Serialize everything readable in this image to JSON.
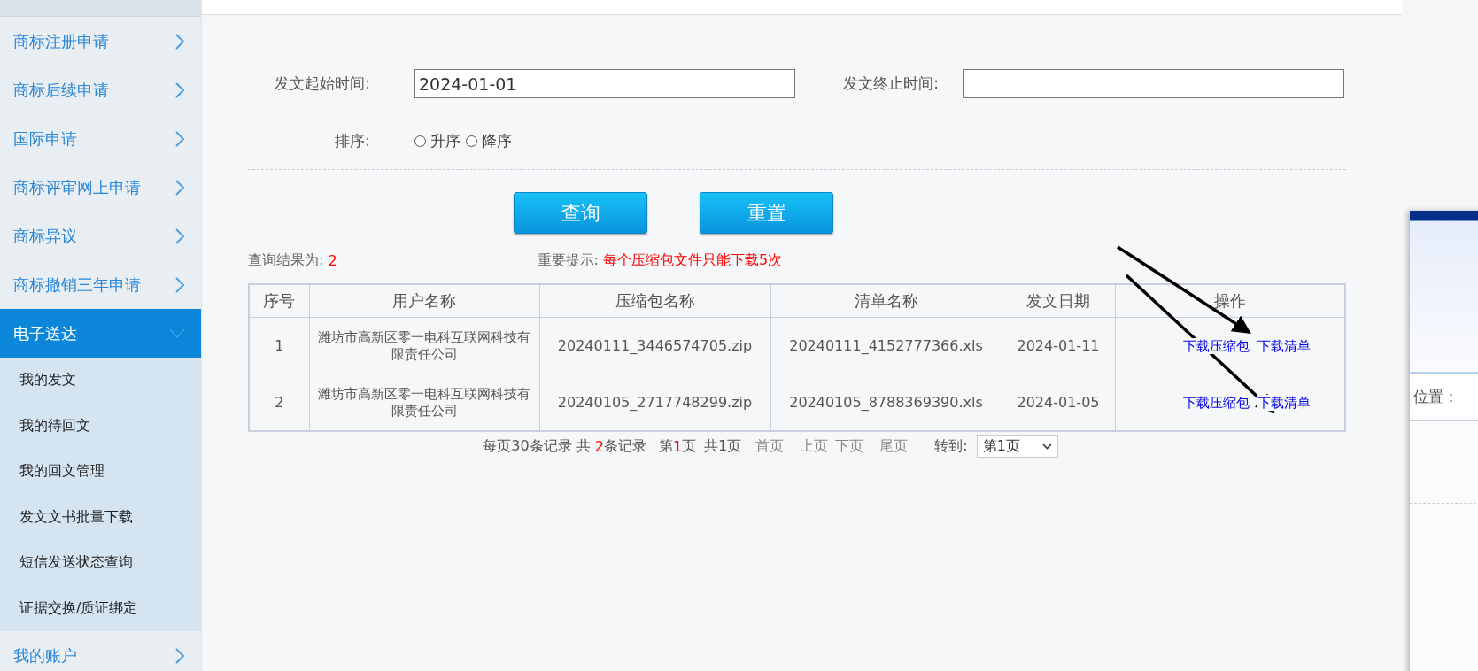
{
  "sidebar": {
    "items": [
      {
        "label": "商标注册申请",
        "expanded": false
      },
      {
        "label": "商标后续申请",
        "expanded": false
      },
      {
        "label": "国际申请",
        "expanded": false
      },
      {
        "label": "商标评审网上申请",
        "expanded": false
      },
      {
        "label": "商标异议",
        "expanded": false
      },
      {
        "label": "商标撤销三年申请",
        "expanded": false
      },
      {
        "label": "电子送达",
        "expanded": true,
        "children": [
          {
            "label": "我的发文"
          },
          {
            "label": "我的待回文"
          },
          {
            "label": "我的回文管理"
          },
          {
            "label": "发文文书批量下载"
          },
          {
            "label": "短信发送状态查询"
          },
          {
            "label": "证据交换/质证绑定"
          }
        ]
      },
      {
        "label": "我的账户",
        "expanded": false
      }
    ]
  },
  "form": {
    "start_label": "发文起始时间:",
    "start_value": "2024-01-01",
    "end_label": "发文终止时间:",
    "sort_label": "排序:",
    "sort_options": [
      {
        "label": "升序",
        "selected": false
      },
      {
        "label": "降序",
        "selected": false
      }
    ],
    "buttons": [
      "查询",
      "重置"
    ]
  },
  "result": {
    "label": "查询结果为:",
    "count": "2",
    "notice_label": "重要提示:",
    "notice": "每个压缩包文件只能下载5次"
  },
  "table": {
    "columns": [
      "序号",
      "用户名称",
      "压缩包名称",
      "清单名称",
      "发文日期",
      "操作"
    ],
    "rows": [
      {
        "index": "1",
        "user": "潍坊市高新区零一电科互联网科技有限责任公司",
        "zip": "20240111_3446574705.zip",
        "list": "20240111_4152777366.xls",
        "date": "2024-01-11",
        "actions": [
          "下载压缩包",
          "下载清单"
        ]
      },
      {
        "index": "2",
        "user": "潍坊市高新区零一电科互联网科技有限责任公司",
        "zip": "20240105_2717748299.zip",
        "list": "20240105_8788369390.xls",
        "date": "2024-01-05",
        "actions": [
          "下载压缩包",
          "下载清单"
        ]
      }
    ]
  },
  "pagination": {
    "per_page": "每页30条记录",
    "total_prefix": "共",
    "total": "2",
    "total_suffix": "条记录",
    "page_prefix": "第",
    "page": "1",
    "page_suffix": "页",
    "page_count": "共1页",
    "links": [
      "首页",
      "上页",
      "下页",
      "尾页"
    ],
    "goto_label": "转到:",
    "goto_value": "第1页"
  },
  "side_window": {
    "location_label": "位置："
  }
}
